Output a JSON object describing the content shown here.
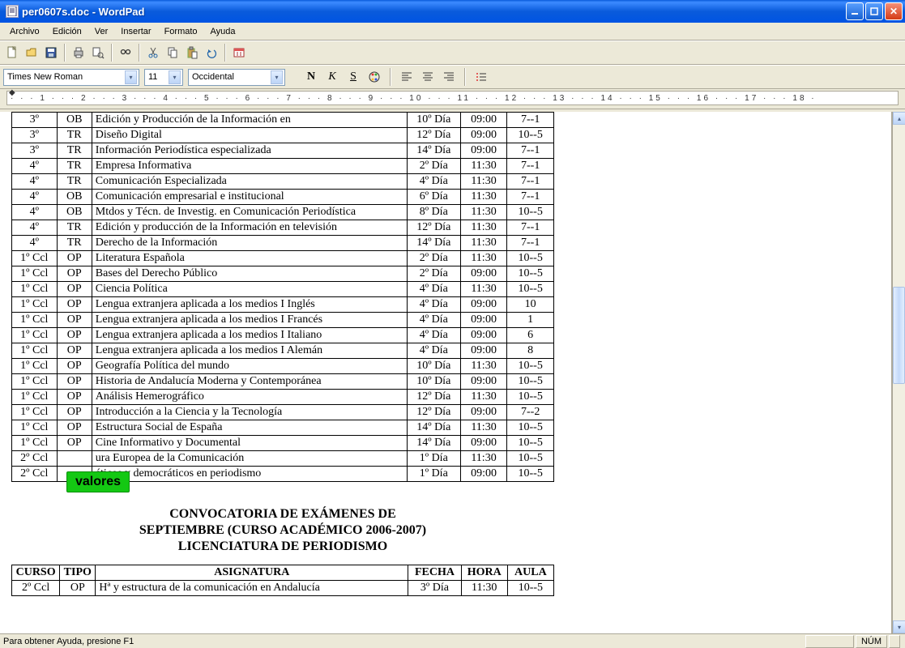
{
  "window": {
    "title": "per0607s.doc - WordPad"
  },
  "menu": [
    "Archivo",
    "Edición",
    "Ver",
    "Insertar",
    "Formato",
    "Ayuda"
  ],
  "font": {
    "name": "Times New Roman",
    "size": "11",
    "script": "Occidental"
  },
  "ruler_text": "· · · 1 · · · 2 · · · 3 · · · 4 · · · 5 · · · 6 · · · 7 · · · 8 · · · 9 · · · 10 · · · 11 · · · 12 · · · 13 · · · 14 · · · 15 · · · 16 · · · 17 · · · 18 ·",
  "status": {
    "help": "Para obtener Ayuda, presione F1",
    "num": "NÚM"
  },
  "overlay": "valores",
  "heading": "CONVOCATORIA DE EXÁMENES DE SEPTIEMBRE (CURSO ACADÉMICO 2006-2007) LICENCIATURA DE PERIODISMO",
  "headers2": {
    "curso": "CURSO",
    "tipo": "TIPO",
    "asig": "ASIGNATURA",
    "fecha": "FECHA",
    "hora": "HORA",
    "aula": "AULA"
  },
  "rows": [
    [
      "3º",
      "OB",
      "Edición y Producción de la Información en",
      "10º Día",
      "09:00",
      "7--1"
    ],
    [
      "3º",
      "TR",
      "Diseño Digital",
      "12º Día",
      "09:00",
      "10--5"
    ],
    [
      "3º",
      "TR",
      "Información Periodística especializada",
      "14º Día",
      "09:00",
      "7--1"
    ],
    [
      "4º",
      "TR",
      "Empresa Informativa",
      "2º Día",
      "11:30",
      "7--1"
    ],
    [
      "4º",
      "TR",
      "Comunicación Especializada",
      "4º Día",
      "11:30",
      "7--1"
    ],
    [
      "4º",
      "OB",
      "Comunicación empresarial e institucional",
      "6º Día",
      "11:30",
      "7--1"
    ],
    [
      "4º",
      "OB",
      "Mtdos y Técn. de Investig. en Comunicación Periodística",
      "8º Día",
      "11:30",
      "10--5"
    ],
    [
      "4º",
      "TR",
      "Edición y producción de la Información en televisión",
      "12º Día",
      "11:30",
      "7--1"
    ],
    [
      "4º",
      "TR",
      "Derecho de la Información",
      "14º Día",
      "11:30",
      "7--1"
    ],
    [
      "1º Ccl",
      "OP",
      "Literatura Española",
      "2º Día",
      "11:30",
      "10--5"
    ],
    [
      "1º Ccl",
      "OP",
      "Bases del Derecho Público",
      "2º Día",
      "09:00",
      "10--5"
    ],
    [
      "1º Ccl",
      "OP",
      "Ciencia Política",
      "4º Día",
      "11:30",
      "10--5"
    ],
    [
      "1º Ccl",
      "OP",
      "Lengua extranjera aplicada a los medios I Inglés",
      "4º Día",
      "09:00",
      "10"
    ],
    [
      "1º Ccl",
      "OP",
      "Lengua extranjera aplicada a los medios I Francés",
      "4º Día",
      "09:00",
      "1"
    ],
    [
      "1º Ccl",
      "OP",
      "Lengua extranjera aplicada a los medios I Italiano",
      "4º Día",
      "09:00",
      "6"
    ],
    [
      "1º Ccl",
      "OP",
      "Lengua extranjera aplicada a los medios I Alemán",
      "4º Día",
      "09:00",
      "8"
    ],
    [
      "1º Ccl",
      "OP",
      "Geografía Política del mundo",
      "10º Día",
      "11:30",
      "10--5"
    ],
    [
      "1º Ccl",
      "OP",
      "Historia de Andalucía Moderna y Contemporánea",
      "10º Día",
      "09:00",
      "10--5"
    ],
    [
      "1º Ccl",
      "OP",
      "Análisis Hemerográfico",
      "12º Día",
      "11:30",
      "10--5"
    ],
    [
      "1º Ccl",
      "OP",
      "Introducción a la Ciencia y la Tecnología",
      "12º Día",
      "09:00",
      "7--2"
    ],
    [
      "1º Ccl",
      "OP",
      "Estructura Social de España",
      "14º Día",
      "11:30",
      "10--5"
    ],
    [
      "1º Ccl",
      "OP",
      "Cine Informativo y Documental",
      "14º Día",
      "09:00",
      "10--5"
    ],
    [
      "2º Ccl",
      "",
      "          ura Europea de la Comunicación",
      "1º Día",
      "11:30",
      "10--5"
    ],
    [
      "2º Ccl",
      "",
      "          éticos y democráticos en periodismo",
      "1º Día",
      "09:00",
      "10--5"
    ]
  ],
  "rows2": [
    [
      "2º Ccl",
      "OP",
      "Hª y estructura de la comunicación en Andalucía",
      "3º Día",
      "11:30",
      "10--5"
    ]
  ]
}
